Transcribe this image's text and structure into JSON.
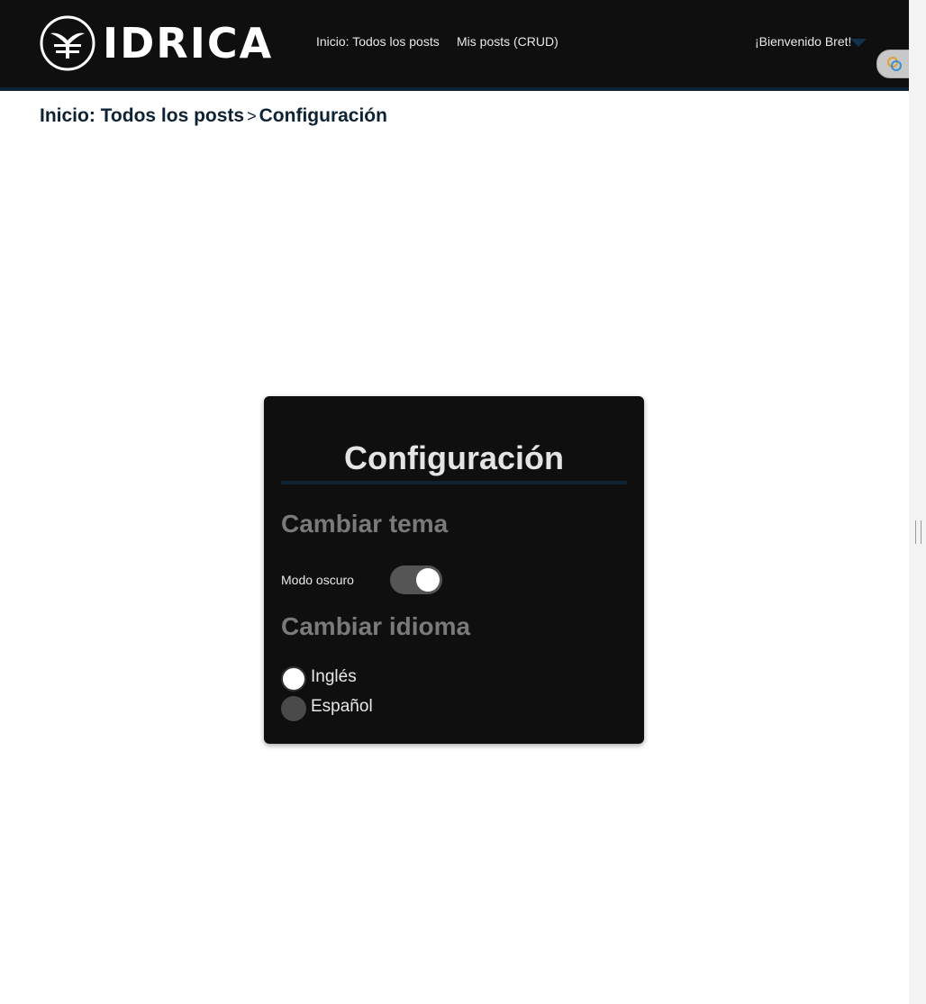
{
  "header": {
    "logo_text": "IDRICA",
    "nav": [
      {
        "label": "Inicio: Todos los posts"
      },
      {
        "label": "Mis posts (CRUD)"
      }
    ],
    "welcome": "¡Bienvenido Bret!"
  },
  "breadcrumb": {
    "home": "Inicio: Todos los posts",
    "separator": ">",
    "current": "Configuración"
  },
  "settings": {
    "title": "Configuración",
    "theme": {
      "heading": "Cambiar tema",
      "dark_mode_label": "Modo oscuro",
      "dark_mode_on": true
    },
    "language": {
      "heading": "Cambiar idioma",
      "options": [
        {
          "label": "Inglés",
          "selected": true
        },
        {
          "label": "Español",
          "selected": false
        }
      ]
    }
  },
  "colors": {
    "navbar": "#0f0f0f",
    "accent_dark_blue": "#0d2233",
    "card": "#0f0f0f",
    "muted_heading": "#7a7a7a"
  }
}
